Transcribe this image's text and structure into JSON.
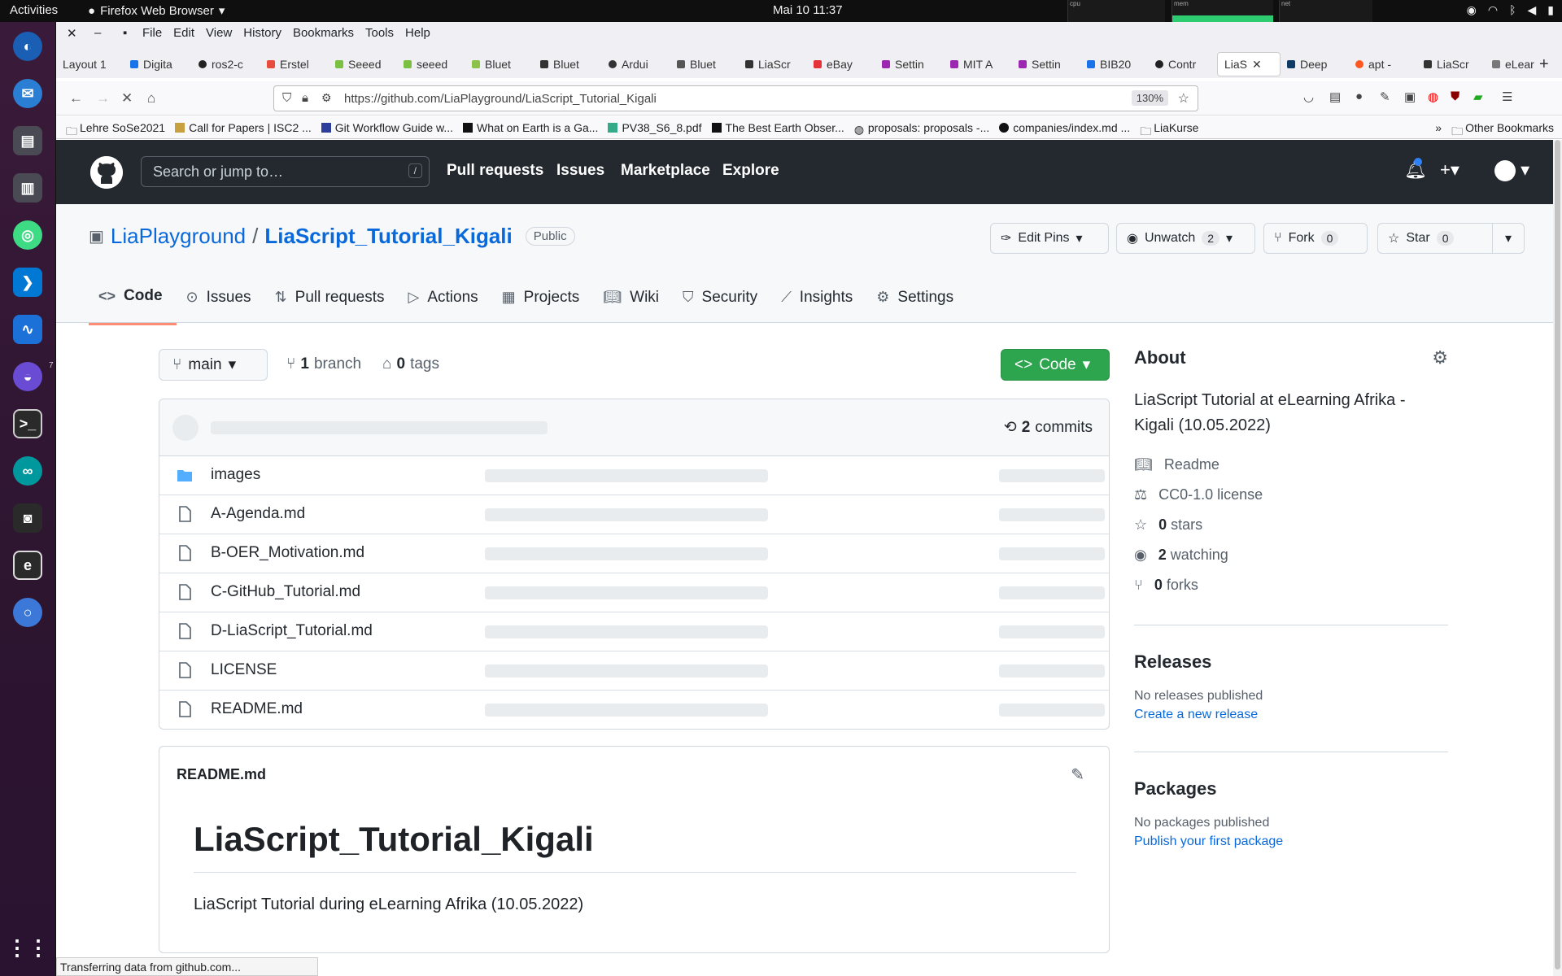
{
  "system": {
    "activities": "Activities",
    "app_name": "Firefox Web Browser",
    "clock": "Mai 10  11:37",
    "meters": [
      "cpu",
      "mem",
      "net"
    ]
  },
  "dock": {
    "apps": [
      "firefox-icon",
      "thunderbird-icon",
      "notes-icon",
      "document-icon",
      "android-studio-icon",
      "vscode-icon",
      "monitor-icon",
      "joplin-icon",
      "terminal-icon",
      "arduino-icon",
      "camera-icon",
      "editor-icon",
      "chromium-icon",
      "app-grid-icon"
    ],
    "badge": "7"
  },
  "browser": {
    "menu": [
      "File",
      "Edit",
      "View",
      "History",
      "Bookmarks",
      "Tools",
      "Help"
    ],
    "tabs": [
      "Layout 1",
      "Digita",
      "ros2-c",
      "Erstel",
      "Seeed",
      "seeed",
      "Bluet",
      "Bluet",
      "Ardui",
      "Bluet",
      "LiaScr",
      "eBay",
      "Settin",
      "MIT A",
      "Settin",
      "BIB20",
      "Contr",
      "LiaS",
      "Deep",
      "apt -",
      "LiaScr",
      "eLear"
    ],
    "active_tab_index": 17,
    "url": "https://github.com/LiaPlayground/LiaScript_Tutorial_Kigali",
    "zoom": "130%",
    "bookmarks": [
      "Lehre SoSe2021",
      "Call for Papers | ISC2 ...",
      "Git Workflow Guide w...",
      "What on Earth is a Ga...",
      "PV38_S6_8.pdf",
      "The Best Earth Obser...",
      "proposals: proposals -...",
      "companies/index.md ...",
      "LiaKurse"
    ],
    "other_bookmarks": "Other Bookmarks",
    "status": "Transferring data from github.com..."
  },
  "github": {
    "search_placeholder": "Search or jump to…",
    "search_key": "/",
    "nav": [
      "Pull requests",
      "Issues",
      "Marketplace",
      "Explore"
    ],
    "owner": "LiaPlayground",
    "repo": "LiaScript_Tutorial_Kigali",
    "visibility": "Public",
    "edit_pins": "Edit Pins",
    "unwatch": "Unwatch",
    "unwatch_count": "2",
    "fork": "Fork",
    "fork_count": "0",
    "star": "Star",
    "star_count": "0",
    "tabs": [
      "Code",
      "Issues",
      "Pull requests",
      "Actions",
      "Projects",
      "Wiki",
      "Security",
      "Insights",
      "Settings"
    ],
    "branch": "main",
    "branch_count": "1",
    "branch_label": "branch",
    "tag_count": "0",
    "tag_label": "tags",
    "code_button": "Code",
    "commits_count": "2",
    "commits_label": "commits",
    "files": [
      {
        "name": "images",
        "type": "folder"
      },
      {
        "name": "A-Agenda.md",
        "type": "file"
      },
      {
        "name": "B-OER_Motivation.md",
        "type": "file"
      },
      {
        "name": "C-GitHub_Tutorial.md",
        "type": "file"
      },
      {
        "name": "D-LiaScript_Tutorial.md",
        "type": "file"
      },
      {
        "name": "LICENSE",
        "type": "file"
      },
      {
        "name": "README.md",
        "type": "file"
      }
    ],
    "readme": {
      "filename": "README.md",
      "title": "LiaScript_Tutorial_Kigali",
      "text": "LiaScript Tutorial during eLearning Afrika (10.05.2022)"
    },
    "about": {
      "heading": "About",
      "description": "LiaScript Tutorial at eLearning Afrika - Kigali (10.05.2022)",
      "readme": "Readme",
      "license": "CC0-1.0 license",
      "stars_count": "0",
      "stars_label": "stars",
      "watching_count": "2",
      "watching_label": "watching",
      "forks_count": "0",
      "forks_label": "forks"
    },
    "releases": {
      "heading": "Releases",
      "text": "No releases published",
      "link": "Create a new release"
    },
    "packages": {
      "heading": "Packages",
      "text": "No packages published",
      "link": "Publish your first package"
    }
  }
}
